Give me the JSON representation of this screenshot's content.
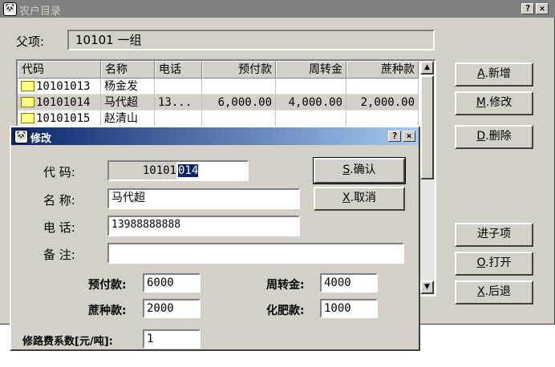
{
  "window": {
    "title": "农户目录",
    "help": "?",
    "close": "×",
    "icon": "🐼"
  },
  "parent": {
    "label": "父项:",
    "value": "10101   一组"
  },
  "list": {
    "columns": [
      "代码",
      "名称",
      "电话",
      "预付款",
      "周转金",
      "蔗种款"
    ],
    "rows": [
      [
        "10101013",
        "杨金发",
        "",
        "",
        "",
        ""
      ],
      [
        "10101014",
        "马代超",
        "13...",
        "6,000.00",
        "4,000.00",
        "2,000.00"
      ],
      [
        "10101015",
        "赵清山",
        "",
        "",
        "",
        ""
      ]
    ],
    "scroll_up": "▲",
    "scroll_down": "▼"
  },
  "buttons": {
    "add": {
      "key": "A",
      "label": ".新增"
    },
    "modify": {
      "key": "M",
      "label": ".修改"
    },
    "delete": {
      "key": "D",
      "label": ".删除"
    },
    "enter_child": {
      "label": "进子项"
    },
    "open": {
      "key": "O",
      "label": ".打开"
    },
    "back": {
      "key": "X",
      "label": ".后退"
    }
  },
  "dialog": {
    "title": "修改",
    "help": "?",
    "close": "×",
    "code_label": "代  码:",
    "code_prefix": "10101",
    "code_value": "014",
    "name_label": "名  称:",
    "name_value": "马代超",
    "phone_label": "电  话:",
    "phone_value": "13988888888",
    "note_label": "备  注:",
    "note_value": "",
    "prepay_label": "预付款:",
    "prepay_value": "6000",
    "turnover_label": "周转金:",
    "turnover_value": "4000",
    "seed_label": "蔗种款:",
    "seed_value": "2000",
    "fert_label": "化肥款:",
    "fert_value": "1000",
    "road_label": "修路费系数[元/吨]:",
    "road_value": "1",
    "ok": {
      "key": "S",
      "label": ".确认"
    },
    "cancel": {
      "key": "X",
      "label": ".取消"
    }
  }
}
